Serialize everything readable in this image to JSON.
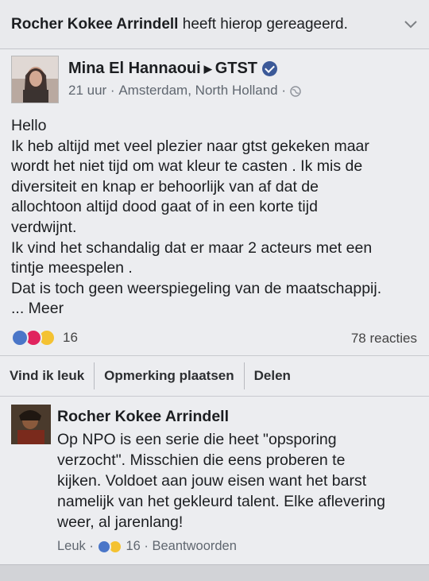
{
  "notification": {
    "actor": "Rocher Kokee Arrindell",
    "text": " heeft hierop gereageerd.",
    "chevron_icon": "chevron-down-icon"
  },
  "post": {
    "author": "Mina El Hannaoui",
    "target_page": "GTST",
    "time": "21 uur",
    "location": "Amsterdam, North Holland",
    "body": [
      "Hello",
      "Ik heb altijd met veel plezier naar gtst gekeken maar",
      "wordt het niet tijd om wat kleur te casten . Ik mis de",
      "diversiteit en knap er behoorlijk van af dat de",
      "allochtoon altijd dood gaat of in een korte tijd",
      "verdwijnt.",
      "Ik vind het schandalig dat er maar 2 acteurs met een",
      "tintje meespelen .",
      "Dat is toch geen weerspiegeling van de maatschappij."
    ],
    "more_label": "... Meer",
    "reaction_count": "16",
    "comments_count": "78 reacties"
  },
  "actions": {
    "like": "Vind ik leuk",
    "comment": "Opmerking plaatsen",
    "share": "Delen"
  },
  "comment": {
    "author": "Rocher Kokee Arrindell",
    "body": [
      "Op NPO is een serie die heet \"opsporing",
      "verzocht\". Misschien die eens proberen te",
      "kijken. Voldoet aan jouw eisen want het barst",
      "namelijk van het gekleurd talent. Elke aflevering",
      "weer, al jarenlang!"
    ],
    "like_label": "Leuk",
    "reaction_count": "16",
    "reply_label": "Beantwoorden"
  },
  "colors": {
    "like_blue": "#4a76c8",
    "love_red": "#e0245e",
    "haha_yellow": "#f4c232",
    "verified_blue": "#3b5998"
  }
}
